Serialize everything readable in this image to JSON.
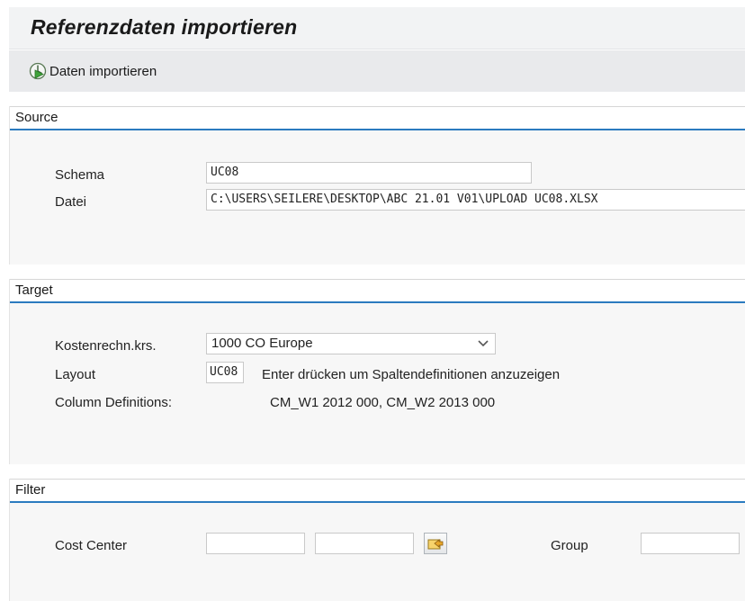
{
  "title": "Referenzdaten importieren",
  "toolbar": {
    "import_label": "Daten importieren",
    "import_icon": "execute-icon"
  },
  "source": {
    "header": "Source",
    "schema_label": "Schema",
    "schema_value": "UC08",
    "file_label": "Datei",
    "file_value": "C:\\USERS\\SEILERE\\DESKTOP\\ABC 21.01 V01\\UPLOAD UC08.XLSX"
  },
  "target": {
    "header": "Target",
    "controlling_area_label": "Kostenrechn.krs.",
    "controlling_area_value": "1000 CO Europe",
    "layout_label": "Layout",
    "layout_value": "UC08",
    "layout_hint": "Enter drücken um Spaltendefinitionen anzuzeigen",
    "column_def_label": "Column Definitions:",
    "column_def_value": "CM_W1 2012 000, CM_W2 2013 000"
  },
  "filter": {
    "header": "Filter",
    "cost_center_label": "Cost Center",
    "cost_center_from": "",
    "cost_center_to": "",
    "group_label": "Group",
    "group_value": ""
  },
  "colors": {
    "accent": "#2b7bbf",
    "toolbar_bg": "#e9eaec",
    "group_bg": "#f7f7f7"
  }
}
